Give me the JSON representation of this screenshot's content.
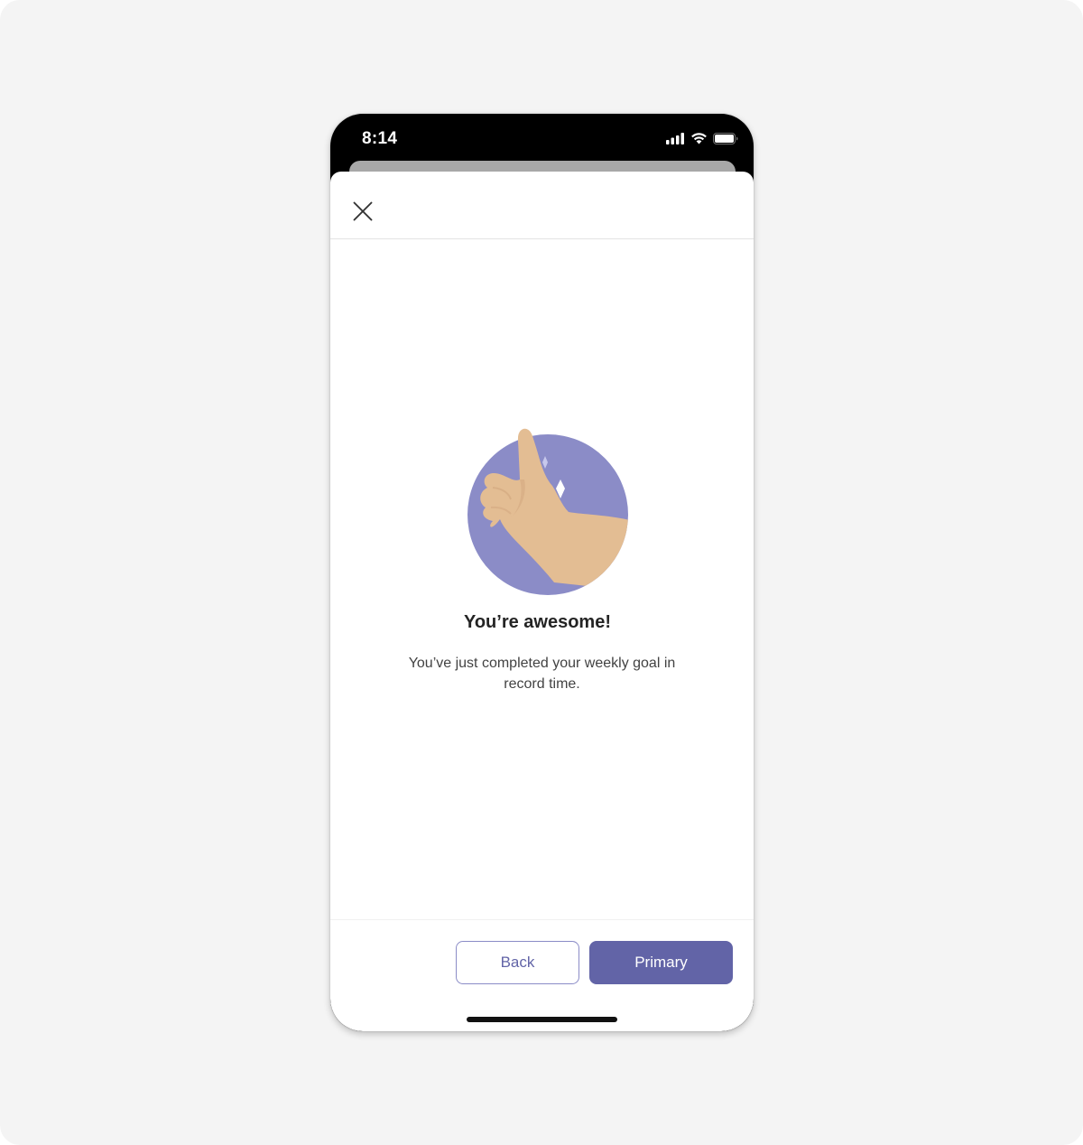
{
  "status_bar": {
    "time": "8:14",
    "icons": [
      "cellular-signal-icon",
      "wifi-icon",
      "battery-icon"
    ]
  },
  "header": {
    "close_icon": "close-icon"
  },
  "content": {
    "illustration": "thumbs-up-illustration",
    "title": "You’re awesome!",
    "message": "You’ve just completed your weekly goal in record time."
  },
  "footer": {
    "back_label": "Back",
    "primary_label": "Primary"
  },
  "colors": {
    "brand": "#6264a7",
    "illustration_circle": "#8b8cc7",
    "skin": "#e3bd93",
    "text": "#242424"
  }
}
